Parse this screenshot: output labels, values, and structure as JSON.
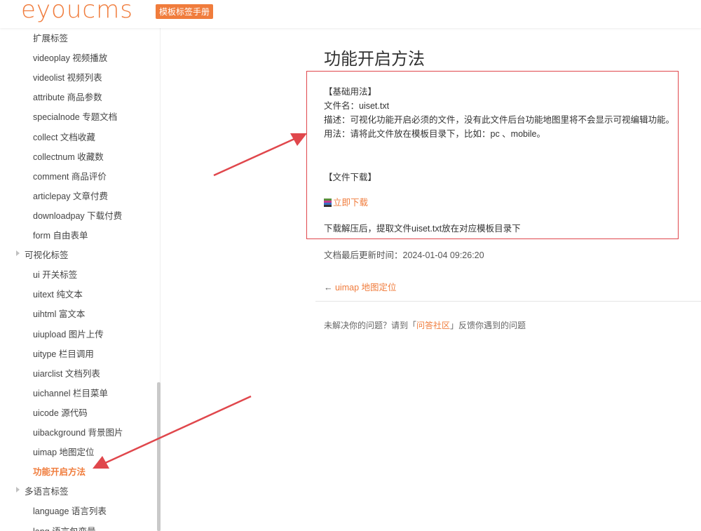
{
  "header": {
    "logo_text": "eyoucms",
    "badge": "模板标签手册"
  },
  "sidebar": {
    "items": [
      {
        "label": "扩展标签",
        "kind": "sub"
      },
      {
        "label": "videoplay 视频播放",
        "kind": "sub"
      },
      {
        "label": "videolist 视频列表",
        "kind": "sub"
      },
      {
        "label": "attribute 商品参数",
        "kind": "sub"
      },
      {
        "label": "specialnode 专题文档",
        "kind": "sub"
      },
      {
        "label": "collect 文档收藏",
        "kind": "sub"
      },
      {
        "label": "collectnum 收藏数",
        "kind": "sub"
      },
      {
        "label": "comment 商品评价",
        "kind": "sub"
      },
      {
        "label": "articlepay 文章付费",
        "kind": "sub"
      },
      {
        "label": "downloadpay 下载付费",
        "kind": "sub"
      },
      {
        "label": "form 自由表单",
        "kind": "sub"
      },
      {
        "label": "可视化标签",
        "kind": "group"
      },
      {
        "label": "ui 开关标签",
        "kind": "sub"
      },
      {
        "label": "uitext 纯文本",
        "kind": "sub"
      },
      {
        "label": "uihtml 富文本",
        "kind": "sub"
      },
      {
        "label": "uiupload 图片上传",
        "kind": "sub"
      },
      {
        "label": "uitype 栏目调用",
        "kind": "sub"
      },
      {
        "label": "uiarclist 文档列表",
        "kind": "sub"
      },
      {
        "label": "uichannel 栏目菜单",
        "kind": "sub"
      },
      {
        "label": "uicode 源代码",
        "kind": "sub"
      },
      {
        "label": "uibackground 背景图片",
        "kind": "sub"
      },
      {
        "label": "uimap 地图定位",
        "kind": "sub"
      },
      {
        "label": "功能开启方法",
        "kind": "active"
      },
      {
        "label": "多语言标签",
        "kind": "group"
      },
      {
        "label": "language 语言列表",
        "kind": "sub"
      },
      {
        "label": "lang 语言包变量",
        "kind": "sub"
      }
    ]
  },
  "content": {
    "title": "功能开启方法",
    "basic_heading": "【基础用法】",
    "filename_line": "文件名：uiset.txt",
    "desc_line": "描述：可视化功能开启必须的文件，没有此文件后台功能地图里将不会显示可视编辑功能。",
    "usage_line": "用法：请将此文件放在模板目录下，比如：pc 、mobile。",
    "download_heading": "【文件下载】",
    "download_link": "立即下载",
    "after_line": "下载解压后，提取文件uiset.txt放在对应模板目录下",
    "updated": "文档最后更新时间：2024-01-04 09:26:20",
    "prev_arrow": "←",
    "prev_link": "uimap 地图定位",
    "footer_prefix": "未解决你的问题？请到「",
    "footer_link": "问答社区",
    "footer_suffix": "」反馈你遇到的问题"
  },
  "colors": {
    "accent": "#f07c3c",
    "annotation_red": "#e0474c"
  }
}
